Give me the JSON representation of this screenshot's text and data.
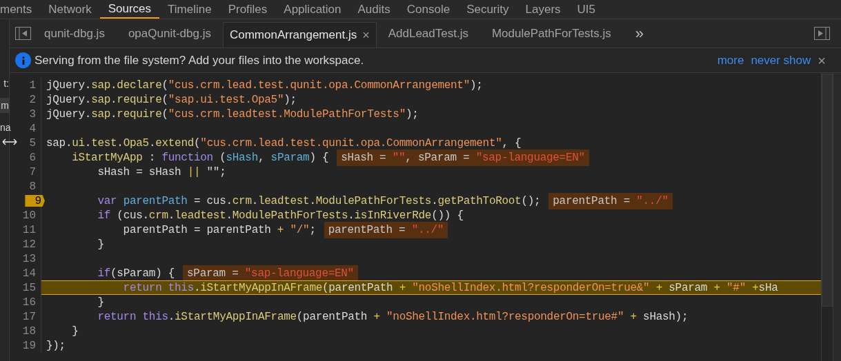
{
  "panel_tabs": [
    {
      "label": "ments",
      "selected": false
    },
    {
      "label": "Network",
      "selected": false
    },
    {
      "label": "Sources",
      "selected": true
    },
    {
      "label": "Timeline",
      "selected": false
    },
    {
      "label": "Profiles",
      "selected": false
    },
    {
      "label": "Application",
      "selected": false
    },
    {
      "label": "Audits",
      "selected": false
    },
    {
      "label": "Console",
      "selected": false
    },
    {
      "label": "Security",
      "selected": false
    },
    {
      "label": "Layers",
      "selected": false
    },
    {
      "label": "UI5",
      "selected": false
    }
  ],
  "file_tabs": [
    {
      "label": "qunit-dbg.js",
      "selected": false
    },
    {
      "label": "opaQunit-dbg.js",
      "selected": false
    },
    {
      "label": "CommonArrangement.js",
      "selected": true,
      "close": "×"
    },
    {
      "label": "AddLeadTest.js",
      "selected": false
    },
    {
      "label": "ModulePathForTests.js",
      "selected": false
    }
  ],
  "file_tabs_overflow": "»",
  "info_bar": {
    "text": "Serving from the file system? Add your files into the workspace.",
    "links": [
      "more",
      "never show"
    ],
    "close": "×"
  },
  "navigator_fragments": [
    {
      "text": "t:",
      "selected": false
    },
    {
      "text": "m",
      "selected": true
    },
    {
      "text": "na",
      "selected": false
    }
  ],
  "code_lines": [
    {
      "number": "1",
      "breakpoint": false,
      "execution": false,
      "tokens": [
        {
          "kind": "plain",
          "text": "jQuery."
        },
        {
          "kind": "member",
          "text": "sap"
        },
        {
          "kind": "plain",
          "text": "."
        },
        {
          "kind": "member",
          "text": "declare"
        },
        {
          "kind": "plain",
          "text": "("
        },
        {
          "kind": "string",
          "text": "\"cus.crm.lead.test.qunit.opa.CommonArrangement\""
        },
        {
          "kind": "plain",
          "text": ");"
        }
      ]
    },
    {
      "number": "2",
      "breakpoint": false,
      "execution": false,
      "tokens": [
        {
          "kind": "plain",
          "text": "jQuery."
        },
        {
          "kind": "member",
          "text": "sap"
        },
        {
          "kind": "plain",
          "text": "."
        },
        {
          "kind": "member",
          "text": "require"
        },
        {
          "kind": "plain",
          "text": "("
        },
        {
          "kind": "string",
          "text": "\"sap.ui.test.Opa5\""
        },
        {
          "kind": "plain",
          "text": ");"
        }
      ]
    },
    {
      "number": "3",
      "breakpoint": false,
      "execution": false,
      "tokens": [
        {
          "kind": "plain",
          "text": "jQuery."
        },
        {
          "kind": "member",
          "text": "sap"
        },
        {
          "kind": "plain",
          "text": "."
        },
        {
          "kind": "member",
          "text": "require"
        },
        {
          "kind": "plain",
          "text": "("
        },
        {
          "kind": "string",
          "text": "\"cus.crm.leadtest.ModulePathForTests\""
        },
        {
          "kind": "plain",
          "text": ");"
        }
      ]
    },
    {
      "number": "4",
      "breakpoint": false,
      "execution": false
    },
    {
      "number": "5",
      "breakpoint": false,
      "execution": false,
      "tokens": [
        {
          "kind": "plain",
          "text": "sap."
        },
        {
          "kind": "member",
          "text": "ui"
        },
        {
          "kind": "plain",
          "text": "."
        },
        {
          "kind": "member",
          "text": "test"
        },
        {
          "kind": "plain",
          "text": "."
        },
        {
          "kind": "member",
          "text": "Opa5"
        },
        {
          "kind": "plain",
          "text": "."
        },
        {
          "kind": "member",
          "text": "extend"
        },
        {
          "kind": "plain",
          "text": "("
        },
        {
          "kind": "string",
          "text": "\"cus.crm.lead.test.qunit.opa.CommonArrangement\""
        },
        {
          "kind": "plain",
          "text": ", {"
        }
      ]
    },
    {
      "number": "6",
      "breakpoint": false,
      "execution": false,
      "tokens": [
        {
          "kind": "member",
          "text": "    iStartMyApp"
        },
        {
          "kind": "plain",
          "text": " : "
        },
        {
          "kind": "keyword",
          "text": "function"
        },
        {
          "kind": "plain",
          "text": " ("
        },
        {
          "kind": "param",
          "text": "sHash"
        },
        {
          "kind": "plain",
          "text": ", "
        },
        {
          "kind": "param",
          "text": "sParam"
        },
        {
          "kind": "plain",
          "text": ") {"
        }
      ],
      "inline_value": [
        {
          "kind": "name",
          "text": "sHash = "
        },
        {
          "kind": "value",
          "text": "\"\""
        },
        {
          "kind": "name",
          "text": ", sParam = "
        },
        {
          "kind": "value",
          "text": "\"sap-language=EN\""
        }
      ]
    },
    {
      "number": "7",
      "breakpoint": false,
      "execution": false,
      "tokens": [
        {
          "kind": "plain",
          "text": "        sHash = sHash "
        },
        {
          "kind": "operator",
          "text": "||"
        },
        {
          "kind": "plain",
          "text": " \"\";"
        }
      ]
    },
    {
      "number": "8",
      "breakpoint": false,
      "execution": false
    },
    {
      "number": "9",
      "breakpoint": true,
      "execution": false,
      "tokens": [
        {
          "kind": "keyword",
          "text": "        var"
        },
        {
          "kind": "param",
          "text": " parentPath"
        },
        {
          "kind": "plain",
          "text": " = cus."
        },
        {
          "kind": "member",
          "text": "crm"
        },
        {
          "kind": "plain",
          "text": "."
        },
        {
          "kind": "member",
          "text": "leadtest"
        },
        {
          "kind": "plain",
          "text": "."
        },
        {
          "kind": "member",
          "text": "ModulePathForTests"
        },
        {
          "kind": "plain",
          "text": "."
        },
        {
          "kind": "member",
          "text": "getPathToRoot"
        },
        {
          "kind": "plain",
          "text": "();"
        }
      ],
      "inline_value": [
        {
          "kind": "name",
          "text": "parentPath = "
        },
        {
          "kind": "value",
          "text": "\"../\""
        }
      ]
    },
    {
      "number": "10",
      "breakpoint": false,
      "execution": false,
      "tokens": [
        {
          "kind": "keyword",
          "text": "        if"
        },
        {
          "kind": "plain",
          "text": " (cus."
        },
        {
          "kind": "member",
          "text": "crm"
        },
        {
          "kind": "plain",
          "text": "."
        },
        {
          "kind": "member",
          "text": "leadtest"
        },
        {
          "kind": "plain",
          "text": "."
        },
        {
          "kind": "member",
          "text": "ModulePathForTests"
        },
        {
          "kind": "plain",
          "text": "."
        },
        {
          "kind": "member",
          "text": "isInRiverRde"
        },
        {
          "kind": "plain",
          "text": "()) {"
        }
      ]
    },
    {
      "number": "11",
      "breakpoint": false,
      "execution": false,
      "tokens": [
        {
          "kind": "plain",
          "text": "            parentPath = parentPath "
        },
        {
          "kind": "operator",
          "text": "+"
        },
        {
          "kind": "string",
          "text": " \"/\""
        },
        {
          "kind": "plain",
          "text": ";"
        }
      ],
      "inline_value": [
        {
          "kind": "name",
          "text": "parentPath = "
        },
        {
          "kind": "value",
          "text": "\"../\""
        }
      ]
    },
    {
      "number": "12",
      "breakpoint": false,
      "execution": false,
      "tokens": [
        {
          "kind": "plain",
          "text": "        }"
        }
      ]
    },
    {
      "number": "13",
      "breakpoint": false,
      "execution": false
    },
    {
      "number": "14",
      "breakpoint": false,
      "execution": false,
      "tokens": [
        {
          "kind": "keyword",
          "text": "        if"
        },
        {
          "kind": "plain",
          "text": "(sParam) {"
        }
      ],
      "inline_value": [
        {
          "kind": "name",
          "text": "sParam = "
        },
        {
          "kind": "value",
          "text": "\"sap-language=EN\""
        }
      ]
    },
    {
      "number": "15",
      "breakpoint": false,
      "execution": true,
      "tokens": [
        {
          "kind": "keyword",
          "text": "            return"
        },
        {
          "kind": "keyword",
          "text": " this"
        },
        {
          "kind": "plain",
          "text": "."
        },
        {
          "kind": "member",
          "text": "iStartMyAppInAFrame"
        },
        {
          "kind": "plain",
          "text": "(parentPath "
        },
        {
          "kind": "operator",
          "text": "+"
        },
        {
          "kind": "string",
          "text": " \"noShellIndex.html?responderOn=true&\""
        },
        {
          "kind": "operator",
          "text": " +"
        },
        {
          "kind": "plain",
          "text": " sParam "
        },
        {
          "kind": "operator",
          "text": "+"
        },
        {
          "kind": "string",
          "text": " \"#\""
        },
        {
          "kind": "operator",
          "text": " +"
        },
        {
          "kind": "plain",
          "text": "sHa"
        }
      ]
    },
    {
      "number": "16",
      "breakpoint": false,
      "execution": false,
      "tokens": [
        {
          "kind": "plain",
          "text": "        }"
        }
      ]
    },
    {
      "number": "17",
      "breakpoint": false,
      "execution": false,
      "tokens": [
        {
          "kind": "keyword",
          "text": "        return"
        },
        {
          "kind": "keyword",
          "text": " this"
        },
        {
          "kind": "plain",
          "text": "."
        },
        {
          "kind": "member",
          "text": "iStartMyAppInAFrame"
        },
        {
          "kind": "plain",
          "text": "(parentPath "
        },
        {
          "kind": "operator",
          "text": "+"
        },
        {
          "kind": "string",
          "text": " \"noShellIndex.html?responderOn=true#\""
        },
        {
          "kind": "operator",
          "text": " +"
        },
        {
          "kind": "plain",
          "text": " sHash);"
        }
      ]
    },
    {
      "number": "18",
      "breakpoint": false,
      "execution": false,
      "tokens": [
        {
          "kind": "plain",
          "text": "    }"
        }
      ]
    },
    {
      "number": "19",
      "breakpoint": false,
      "execution": false,
      "tokens": [
        {
          "kind": "plain",
          "text": "});"
        }
      ]
    }
  ]
}
